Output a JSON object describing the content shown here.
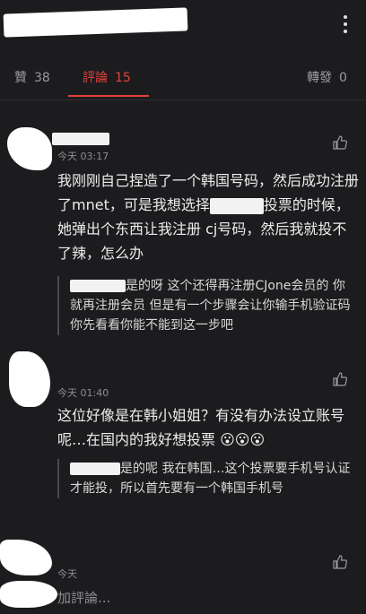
{
  "tabs": [
    {
      "label": "贊",
      "count": "38"
    },
    {
      "label": "評論",
      "count": "15"
    },
    {
      "label": "轉發",
      "count": "0"
    }
  ],
  "comments": [
    {
      "time": "今天 03:17",
      "text_a": "我刚刚自己捏造了一个韩国号码，然后成功注册了mnet，可是我想选择",
      "text_b": "投票的时候，她弹出个东西让我注册 cj号码，然后我就投不了辣，怎么办",
      "reply_a": "是的呀 这个还得再注册CJone会员的 你就再注册会员 但是有一个步骤会让你输手机验证码 你先看看你能不能到这一步吧"
    },
    {
      "time": "今天 01:40",
      "text": "这位好像是在韩小姐姐？有没有办法设立账号呢…在国内的我好想投票",
      "emoji": "😮😮😮",
      "reply": "是的呢 我在韩国…这个投票要手机号认证才能投，所以首先要有一个韩国手机号"
    }
  ],
  "third_time": "今天",
  "reply_placeholder": "加評論..."
}
